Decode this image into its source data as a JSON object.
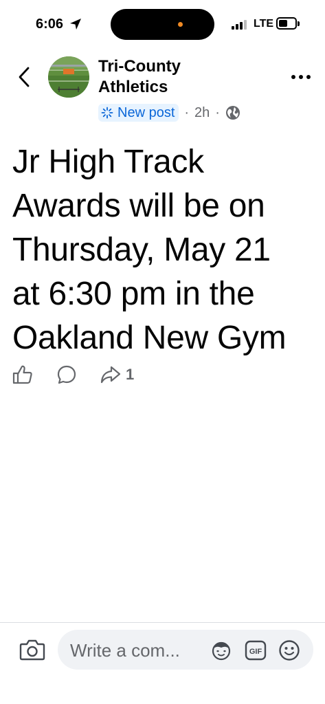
{
  "status_bar": {
    "time": "6:06",
    "carrier": "LTE",
    "location_icon": "location-arrow-icon",
    "signal_icon": "cellular-signal-icon",
    "battery_icon": "battery-icon"
  },
  "header": {
    "back_icon": "chevron-left-icon",
    "page_name_line1": "Tri-County",
    "page_name_line2": "Athletics",
    "badge_label": "New post",
    "badge_icon": "sparkle-icon",
    "time_ago": "2h",
    "separator": "·",
    "privacy_icon": "globe-icon",
    "more_icon": "more-dots-icon"
  },
  "post": {
    "lines": [
      "Jr High Track",
      "Awards will be on",
      "Thursday, May 21",
      "at 6:30 pm in the",
      "Oakland New Gym"
    ]
  },
  "actions": {
    "like_icon": "thumbs-up-icon",
    "comment_icon": "comment-bubble-icon",
    "share_icon": "share-arrow-icon",
    "share_count": "1"
  },
  "composer": {
    "camera_icon": "camera-icon",
    "placeholder": "Write a com...",
    "avatar_sticker_icon": "avatar-sticker-icon",
    "gif_label": "GIF",
    "emoji_icon": "smiley-icon"
  },
  "colors": {
    "badge_text": "#0a66d8",
    "badge_bg": "#e7f3ff",
    "secondary_text": "#65676b",
    "input_bg": "#f0f2f5",
    "island_dot": "#f08a24"
  }
}
